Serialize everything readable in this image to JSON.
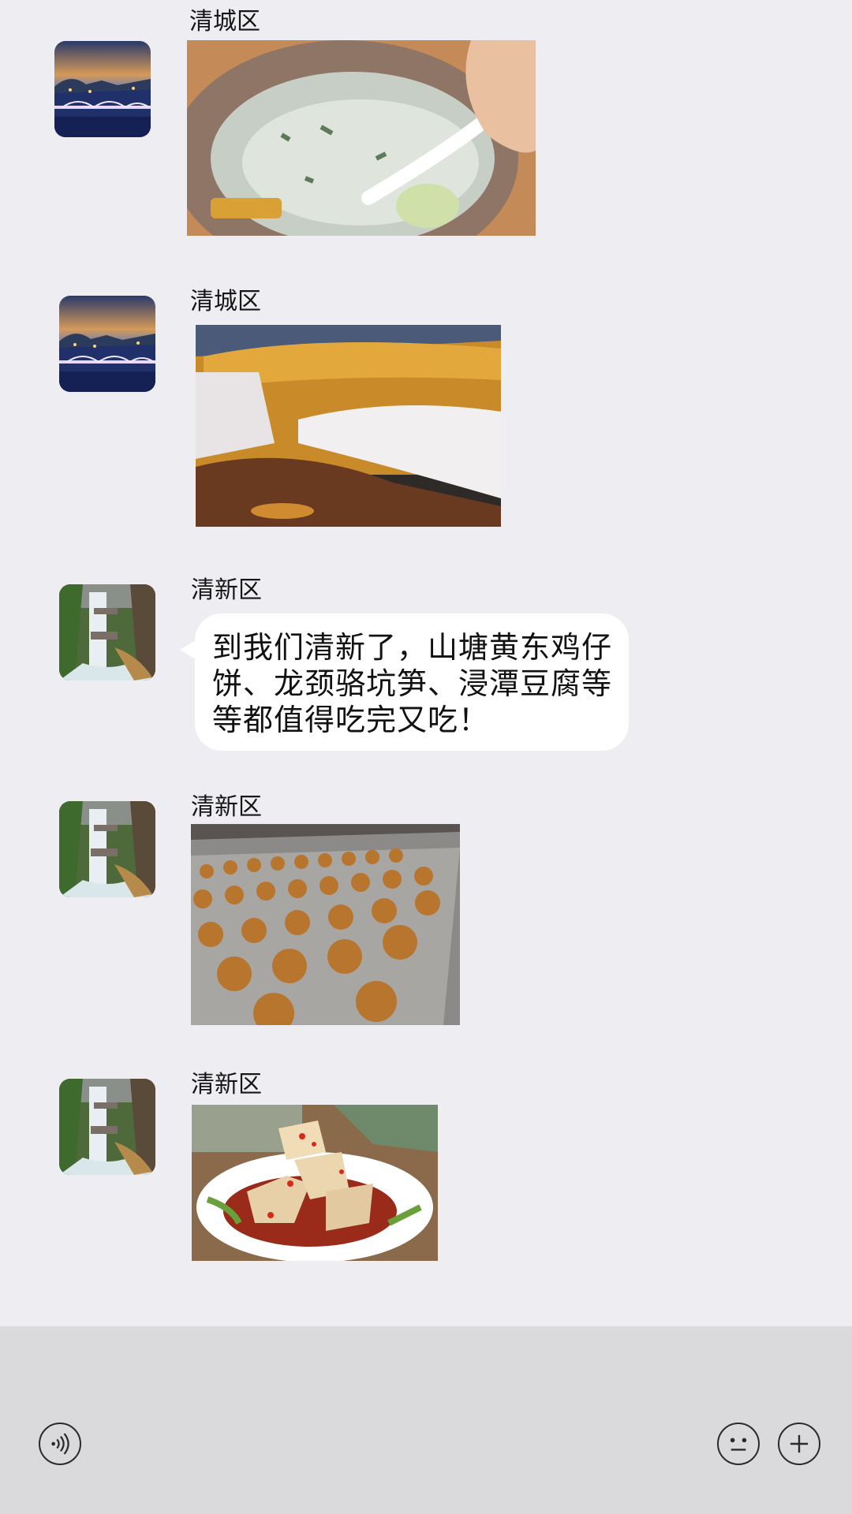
{
  "messages": [
    {
      "sender": "清城区",
      "avatar": "city-night-bridge-avatar",
      "type": "image",
      "image": "clay-pot-congee-photo"
    },
    {
      "sender": "清城区",
      "avatar": "city-night-bridge-avatar",
      "type": "image",
      "image": "roast-goose-photo"
    },
    {
      "sender": "清新区",
      "avatar": "waterfall-avatar",
      "type": "text",
      "text": "到我们清新了，山塘黄东鸡仔饼、龙颈骆坑笋、浸潭豆腐等等都值得吃完又吃！"
    },
    {
      "sender": "清新区",
      "avatar": "waterfall-avatar",
      "type": "image",
      "image": "baked-pastries-tray-photo"
    },
    {
      "sender": "清新区",
      "avatar": "waterfall-avatar",
      "type": "image",
      "image": "tofu-with-chili-photo"
    }
  ],
  "input_bar": {
    "voice_icon": "voice-wave-icon",
    "emoji_icon": "face-icon",
    "plus_icon": "plus-icon"
  },
  "colors": {
    "chat_background": "#eeeef2",
    "input_bar_background": "#dadadc",
    "bubble": "#ffffff"
  }
}
